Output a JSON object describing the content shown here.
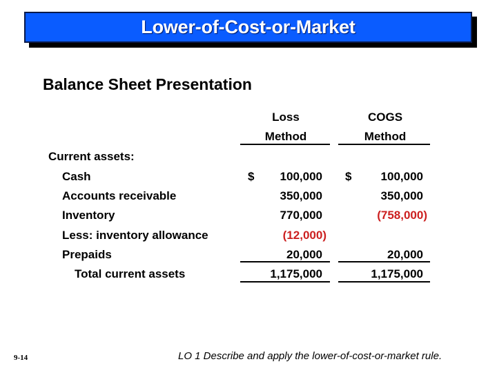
{
  "slide": {
    "title": "Lower-of-Cost-or-Market",
    "subtitle": "Balance Sheet Presentation",
    "colors": {
      "title_bg": "#0a5cff",
      "negative": "#cc1f1f"
    }
  },
  "table": {
    "columns": [
      {
        "line1": "Loss",
        "line2": "Method"
      },
      {
        "line1": "COGS",
        "line2": "Method"
      }
    ],
    "section_label": "Current assets:",
    "currency_symbol": "$",
    "rows": [
      {
        "label": "Cash",
        "loss": "100,000",
        "cogs": "100,000"
      },
      {
        "label": "Accounts receivable",
        "loss": "350,000",
        "cogs": "350,000"
      },
      {
        "label": "Inventory",
        "loss": "770,000",
        "cogs": "(758,000)"
      },
      {
        "label": "Less: inventory allowance",
        "loss": "(12,000)",
        "cogs": ""
      },
      {
        "label": "Prepaids",
        "loss": "20,000",
        "cogs": "20,000"
      }
    ],
    "total": {
      "label": "Total current assets",
      "loss": "1,175,000",
      "cogs": "1,175,000"
    }
  },
  "footer": {
    "slide_number": "9-14",
    "learning_objective": "LO 1  Describe and apply the lower-of-cost-or-market rule."
  }
}
